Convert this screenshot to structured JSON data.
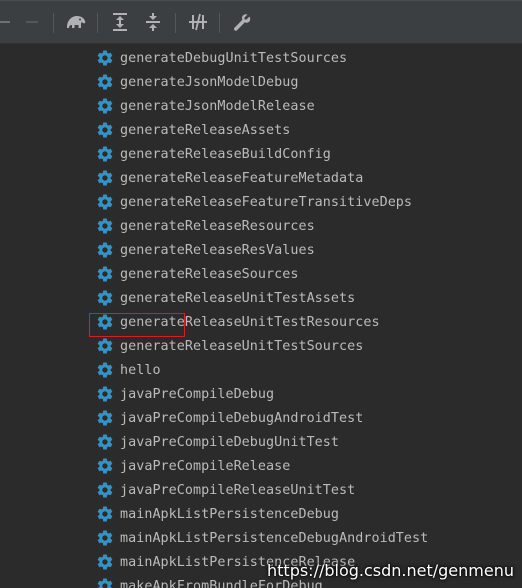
{
  "toolbar": {
    "buttons": [
      {
        "icon": "minus-icon"
      },
      {
        "icon": "minus-icon"
      },
      {
        "icon": "gradle-elephant-icon"
      },
      {
        "icon": "expand-all-icon"
      },
      {
        "icon": "collapse-all-icon"
      },
      {
        "icon": "toggle-offline-icon"
      },
      {
        "icon": "wrench-icon"
      }
    ]
  },
  "tasks": [
    {
      "label": "generateDebugUnitTestSources"
    },
    {
      "label": "generateJsonModelDebug"
    },
    {
      "label": "generateJsonModelRelease"
    },
    {
      "label": "generateReleaseAssets"
    },
    {
      "label": "generateReleaseBuildConfig"
    },
    {
      "label": "generateReleaseFeatureMetadata"
    },
    {
      "label": "generateReleaseFeatureTransitiveDeps"
    },
    {
      "label": "generateReleaseResources"
    },
    {
      "label": "generateReleaseResValues"
    },
    {
      "label": "generateReleaseSources"
    },
    {
      "label": "generateReleaseUnitTestAssets"
    },
    {
      "label": "generateReleaseUnitTestResources"
    },
    {
      "label": "generateReleaseUnitTestSources"
    },
    {
      "label": "hello"
    },
    {
      "label": "javaPreCompileDebug"
    },
    {
      "label": "javaPreCompileDebugAndroidTest"
    },
    {
      "label": "javaPreCompileDebugUnitTest"
    },
    {
      "label": "javaPreCompileRelease"
    },
    {
      "label": "javaPreCompileReleaseUnitTest"
    },
    {
      "label": "mainApkListPersistenceDebug"
    },
    {
      "label": "mainApkListPersistenceDebugAndroidTest"
    },
    {
      "label": "mainApkListPersistenceRelease"
    },
    {
      "label": "makeApkFromBundleForDebug"
    }
  ],
  "watermark": "https://blog.csdn.net/genmenu",
  "colors": {
    "gear": "#3592c4",
    "highlight_border": "#d81e1e",
    "text": "#bbbbbb",
    "background": "#2b2b2b"
  }
}
